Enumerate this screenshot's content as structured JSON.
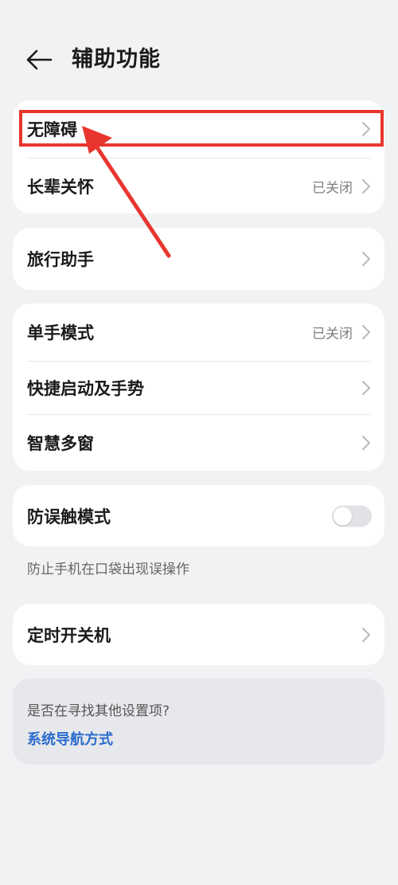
{
  "header": {
    "title": "辅助功能",
    "back_icon": "arrow-left-icon"
  },
  "groups": {
    "group1": {
      "barrier_free": {
        "label": "无障碍"
      },
      "elder_care": {
        "label": "长辈关怀",
        "value": "已关闭"
      }
    },
    "group2": {
      "travel_assistant": {
        "label": "旅行助手"
      }
    },
    "group3": {
      "one_hand_mode": {
        "label": "单手模式",
        "value": "已关闭"
      },
      "quick_launch": {
        "label": "快捷启动及手势"
      },
      "smart_multiwindow": {
        "label": "智慧多窗"
      }
    },
    "group4": {
      "anti_mistouch": {
        "label": "防误触模式",
        "enabled": false
      },
      "hint": "防止手机在口袋出现误操作"
    },
    "group5": {
      "scheduled_power": {
        "label": "定时开关机"
      }
    }
  },
  "suggestion": {
    "question": "是否在寻找其他设置项?",
    "link": "系统导航方式"
  },
  "colors": {
    "background": "#f1f2f4",
    "card": "#ffffff",
    "link": "#2b6ccf",
    "annotation": "#e8362e"
  }
}
